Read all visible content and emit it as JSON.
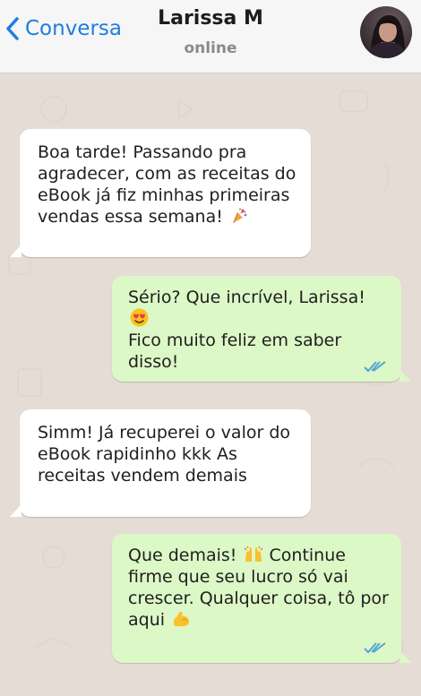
{
  "header": {
    "back_label": "Conversa",
    "contact_name": "Larissa M",
    "contact_status": "online"
  },
  "messages": [
    {
      "direction": "incoming",
      "text": "Boa tarde! Passando pra agradecer, com as receitas do eBook já fiz minhas primeiras vendas essa semana!",
      "emoji": "party-popper-icon"
    },
    {
      "direction": "outgoing",
      "text": "Sério? Que incrível, Larissa!",
      "emoji": "heart-eyes-icon",
      "text2": "Fico muito feliz em saber disso!",
      "status": "read"
    },
    {
      "direction": "incoming",
      "text": "Simm! Já recuperei o valor do eBook rapidinho kkk As receitas vendem demais"
    },
    {
      "direction": "outgoing",
      "text": "Que demais!",
      "emoji": "raised-hands-icon",
      "text2": "Continue firme que seu lucro só vai crescer. Qualquer coisa, tô por aqui",
      "emoji2": "flexed-biceps-icon",
      "status": "read"
    }
  ],
  "colors": {
    "accent": "#1f7de0",
    "incoming_bubble": "#ffffff",
    "outgoing_bubble": "#dcf8c6",
    "chat_background": "#e5ddd5",
    "read_ticks": "#4fa6d8"
  }
}
